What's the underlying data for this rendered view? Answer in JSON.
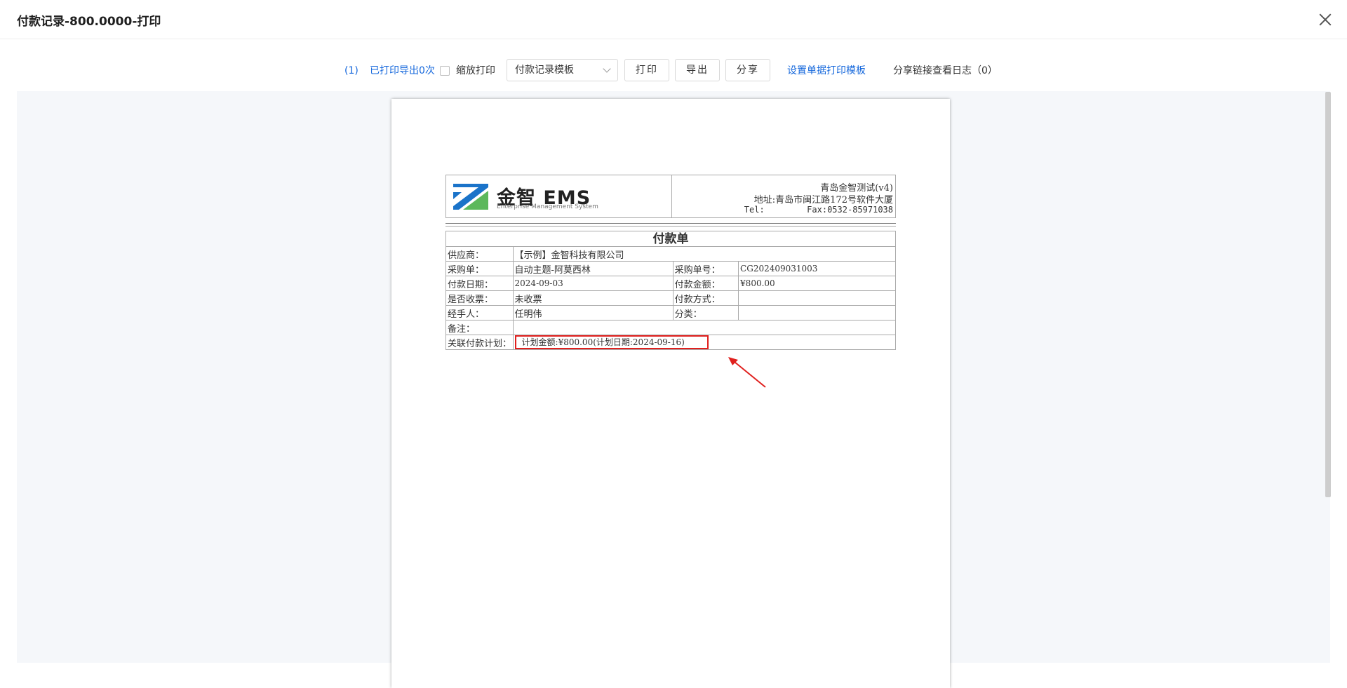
{
  "dialog": {
    "title": "付款记录-800.0000-打印"
  },
  "toolbar": {
    "page_count": "(1)",
    "print_status": "已打印导出0次",
    "scale_print_label": "缩放打印",
    "template_select_value": "付款记录模板",
    "print_button": "打印",
    "export_button": "导出",
    "share_button": "分享",
    "set_template_link": "设置单据打印模板",
    "share_log": "分享链接查看日志（0）"
  },
  "document": {
    "logo": {
      "brand": "金智 EMS",
      "subtitle": "Enterprise Management System"
    },
    "company": {
      "name": "青岛金智测试(v4)",
      "address": "地址:青岛市闽江路172号软件大厦",
      "tel_label": "Tel:",
      "fax": "Fax:0532-85971038"
    },
    "title": "付款单",
    "fields": {
      "supplier_label": "供应商：",
      "supplier_value": "【示例】金智科技有限公司",
      "po_label": "采购单：",
      "po_value": "自动主题-阿莫西林",
      "po_no_label": "采购单号：",
      "po_no_value": "CG202409031003",
      "pay_date_label": "付款日期：",
      "pay_date_value": "2024-09-03",
      "amount_label": "付款金额：",
      "amount_value": "¥800.00",
      "invoice_label": "是否收票：",
      "invoice_value": "未收票",
      "method_label": "付款方式：",
      "method_value": "",
      "handler_label": "经手人：",
      "handler_value": "任明伟",
      "category_label": "分类：",
      "category_value": "",
      "remark_label": "备注：",
      "remark_value": "",
      "plan_label": "关联付款计划：",
      "plan_value": "计划金额:¥800.00(计划日期:2024-09-16)"
    }
  },
  "colors": {
    "accent_blue": "#1668dc",
    "highlight_red": "#e0201e",
    "viewer_bg": "#f5f7fa"
  }
}
